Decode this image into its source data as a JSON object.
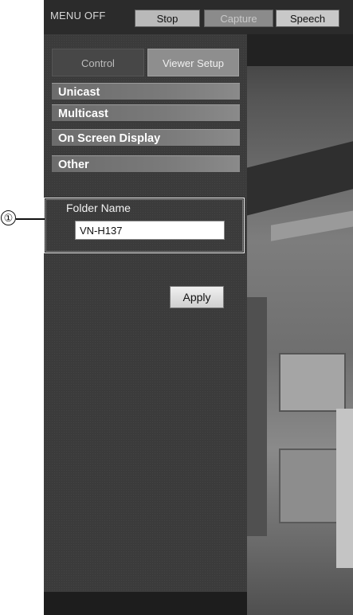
{
  "toolbar": {
    "menu_label": "MENU OFF",
    "stop_label": "Stop",
    "capture_label": "Capture",
    "speech_label": "Speech"
  },
  "tabs": [
    {
      "label": "Control"
    },
    {
      "label": "Viewer Setup"
    }
  ],
  "sections": [
    {
      "label": "Unicast"
    },
    {
      "label": "Multicast"
    },
    {
      "label": "On Screen Display"
    },
    {
      "label": "Other"
    }
  ],
  "folder": {
    "label": "Folder Name",
    "value": "VN-H137"
  },
  "apply_label": "Apply",
  "callout": {
    "number": "①"
  }
}
